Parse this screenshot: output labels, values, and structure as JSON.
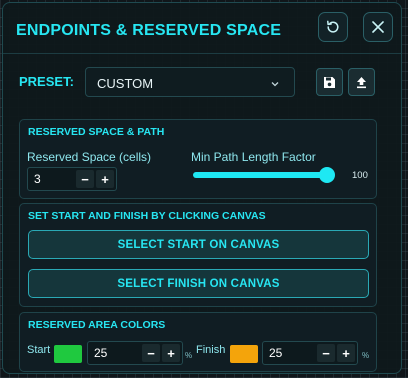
{
  "header": {
    "title": "ENDPOINTS & RESERVED SPACE"
  },
  "preset": {
    "label": "PRESET:",
    "value": "CUSTOM"
  },
  "reserved_section": {
    "title": "RESERVED SPACE & PATH",
    "reserved_label": "Reserved Space (cells)",
    "reserved_value": "3",
    "min_path_label": "Min Path Length Factor",
    "min_path_value": "100",
    "min_path_fill": 1.0
  },
  "start_finish_section": {
    "title": "SET START AND FINISH BY CLICKING CANVAS",
    "select_start_label": "SELECT START ON CANVAS",
    "select_finish_label": "SELECT FINISH ON CANVAS"
  },
  "colors_section": {
    "title": "RESERVED AREA COLORS",
    "start_label": "Start",
    "start_color": "#1fc93f",
    "start_value": "25",
    "start_unit": "%",
    "finish_label": "Finish",
    "finish_color": "#f4a40b",
    "finish_value": "25",
    "finish_unit": "%"
  },
  "stepper": {
    "minus": "−",
    "plus": "+"
  },
  "theme": {
    "accent": "#27e6f2",
    "panel_bg": "#0e181c",
    "border": "#1f4a50"
  }
}
